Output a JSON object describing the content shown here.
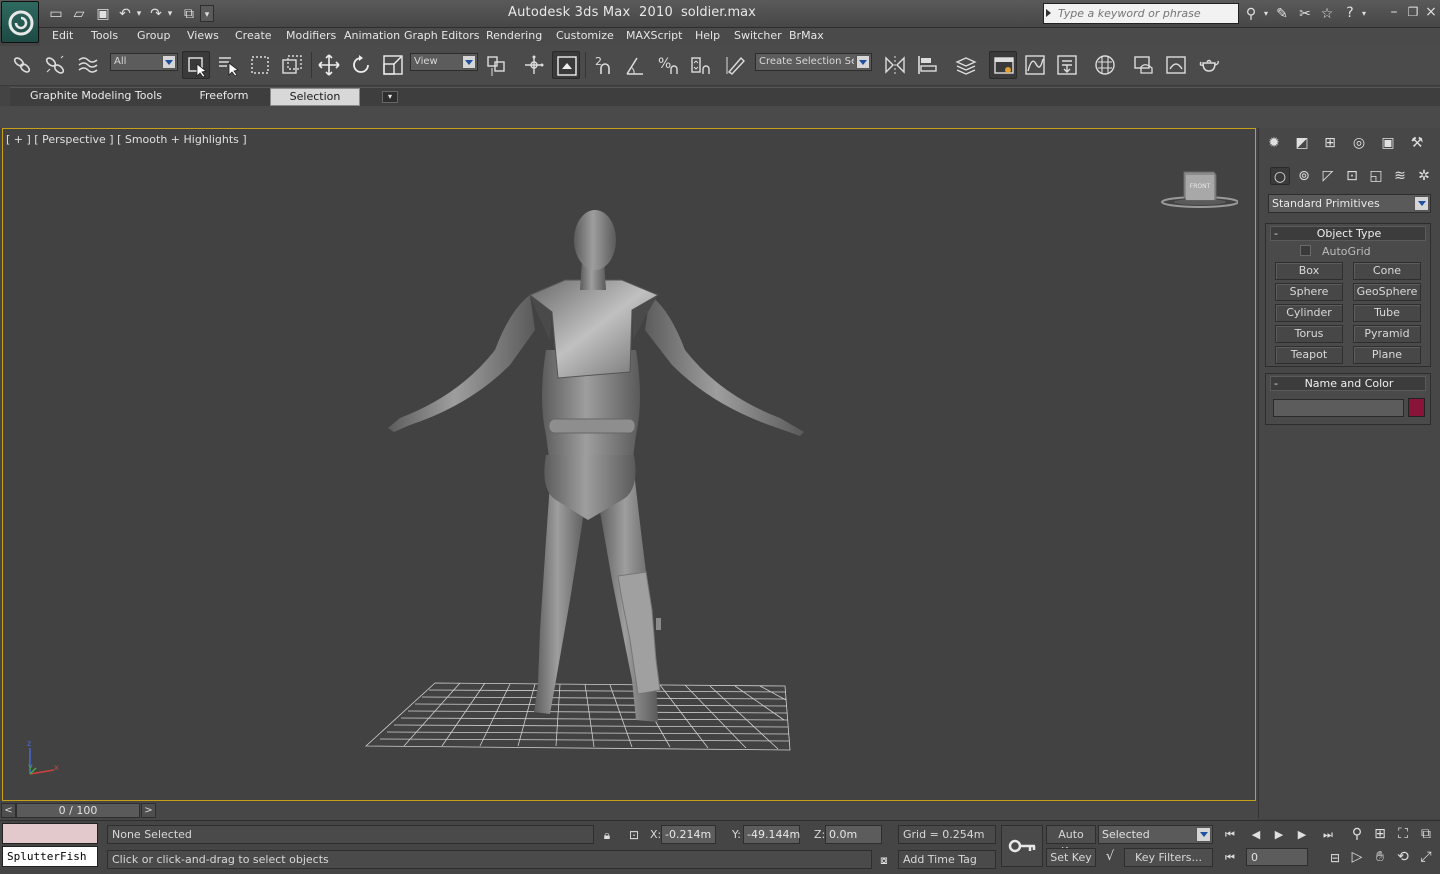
{
  "window": {
    "title": "Autodesk 3ds Max  2010",
    "file": "soldier.max"
  },
  "search": {
    "placeholder": "Type a keyword or phrase"
  },
  "menu": {
    "items": [
      "Edit",
      "Tools",
      "Group",
      "Views",
      "Create",
      "Modifiers",
      "Animation",
      "Graph Editors",
      "Rendering",
      "Customize",
      "MAXScript",
      "Help",
      "Switcher",
      "BrMax"
    ]
  },
  "toolbar": {
    "selection_filter": "All",
    "reference_coord": "View",
    "named_selection": "Create Selection Se"
  },
  "ribbon": {
    "tabs": [
      "Graphite Modeling Tools",
      "Freeform",
      "Selection"
    ],
    "active_tab": "Selection"
  },
  "viewport": {
    "label": "[ + ] [ Perspective ] [ Smooth + Highlights ]",
    "viewcube_face": "FRONT",
    "axis_labels": {
      "z": "z",
      "y": "y",
      "x": "x"
    }
  },
  "command_panel": {
    "category": "Standard Primitives",
    "object_type": {
      "title": "Object Type",
      "autogrid": "AutoGrid",
      "buttons": [
        "Box",
        "Cone",
        "Sphere",
        "GeoSphere",
        "Cylinder",
        "Tube",
        "Torus",
        "Pyramid",
        "Teapot",
        "Plane"
      ]
    },
    "name_and_color": {
      "title": "Name and Color",
      "name_value": "",
      "color": "#8a1437"
    }
  },
  "timeline": {
    "position": "0 / 100",
    "prev": "<",
    "next": ">"
  },
  "status": {
    "listener_text": "SplutterFish",
    "selection": "None Selected",
    "prompt": "Click or click-and-drag to select objects",
    "x": "-0.214m",
    "y": "-49.144m",
    "z": "0.0m",
    "x_label": "X:",
    "y_label": "Y:",
    "z_label": "Z:",
    "grid": "Grid = 0.254m",
    "add_time_tag": "Add Time Tag",
    "auto_key": "Auto Key",
    "set_key": "Set Key",
    "key_mode": "Selected",
    "key_filters": "Key Filters...",
    "current_frame": "0"
  },
  "colors": {
    "viewport_border": "#c7a01a",
    "accent_blue": "#1e50a0"
  }
}
